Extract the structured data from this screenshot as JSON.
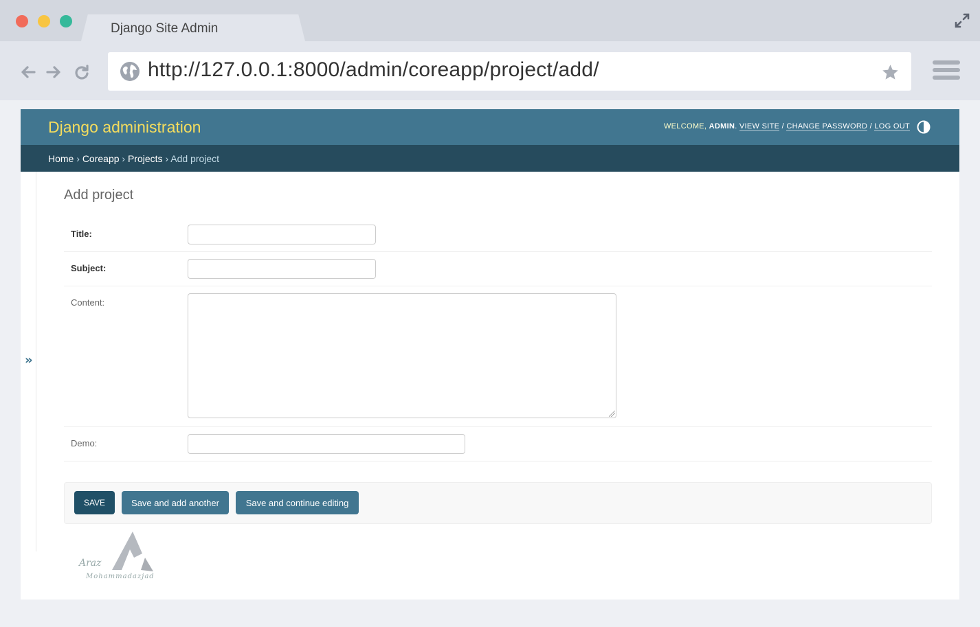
{
  "browser": {
    "tab_title": "Django Site Admin",
    "url": "http://127.0.0.1:8000/admin/coreapp/project/add/"
  },
  "header": {
    "site_name": "Django administration",
    "welcome": "Welcome,",
    "username": "admin",
    "view_site": "View site",
    "change_password": "Change password",
    "log_out": "Log out",
    "sep": "/"
  },
  "breadcrumbs": {
    "home": "Home",
    "app": "Coreapp",
    "model": "Projects",
    "current": "Add project",
    "separator": "›"
  },
  "sidebar": {
    "toggle": "»"
  },
  "content": {
    "title": "Add project",
    "fields": {
      "title_label": "Title:",
      "subject_label": "Subject:",
      "content_label": "Content:",
      "demo_label": "Demo:"
    }
  },
  "submit": {
    "save": "Save",
    "save_add": "Save and add another",
    "save_continue": "Save and continue editing"
  },
  "watermark": {
    "line1": "Araz",
    "line2": "Mohammadazjad"
  },
  "colors": {
    "header_bg": "#417690",
    "breadcrumb_bg": "#264b5d",
    "site_name": "#f5dd5d",
    "default_button": "#205067"
  }
}
